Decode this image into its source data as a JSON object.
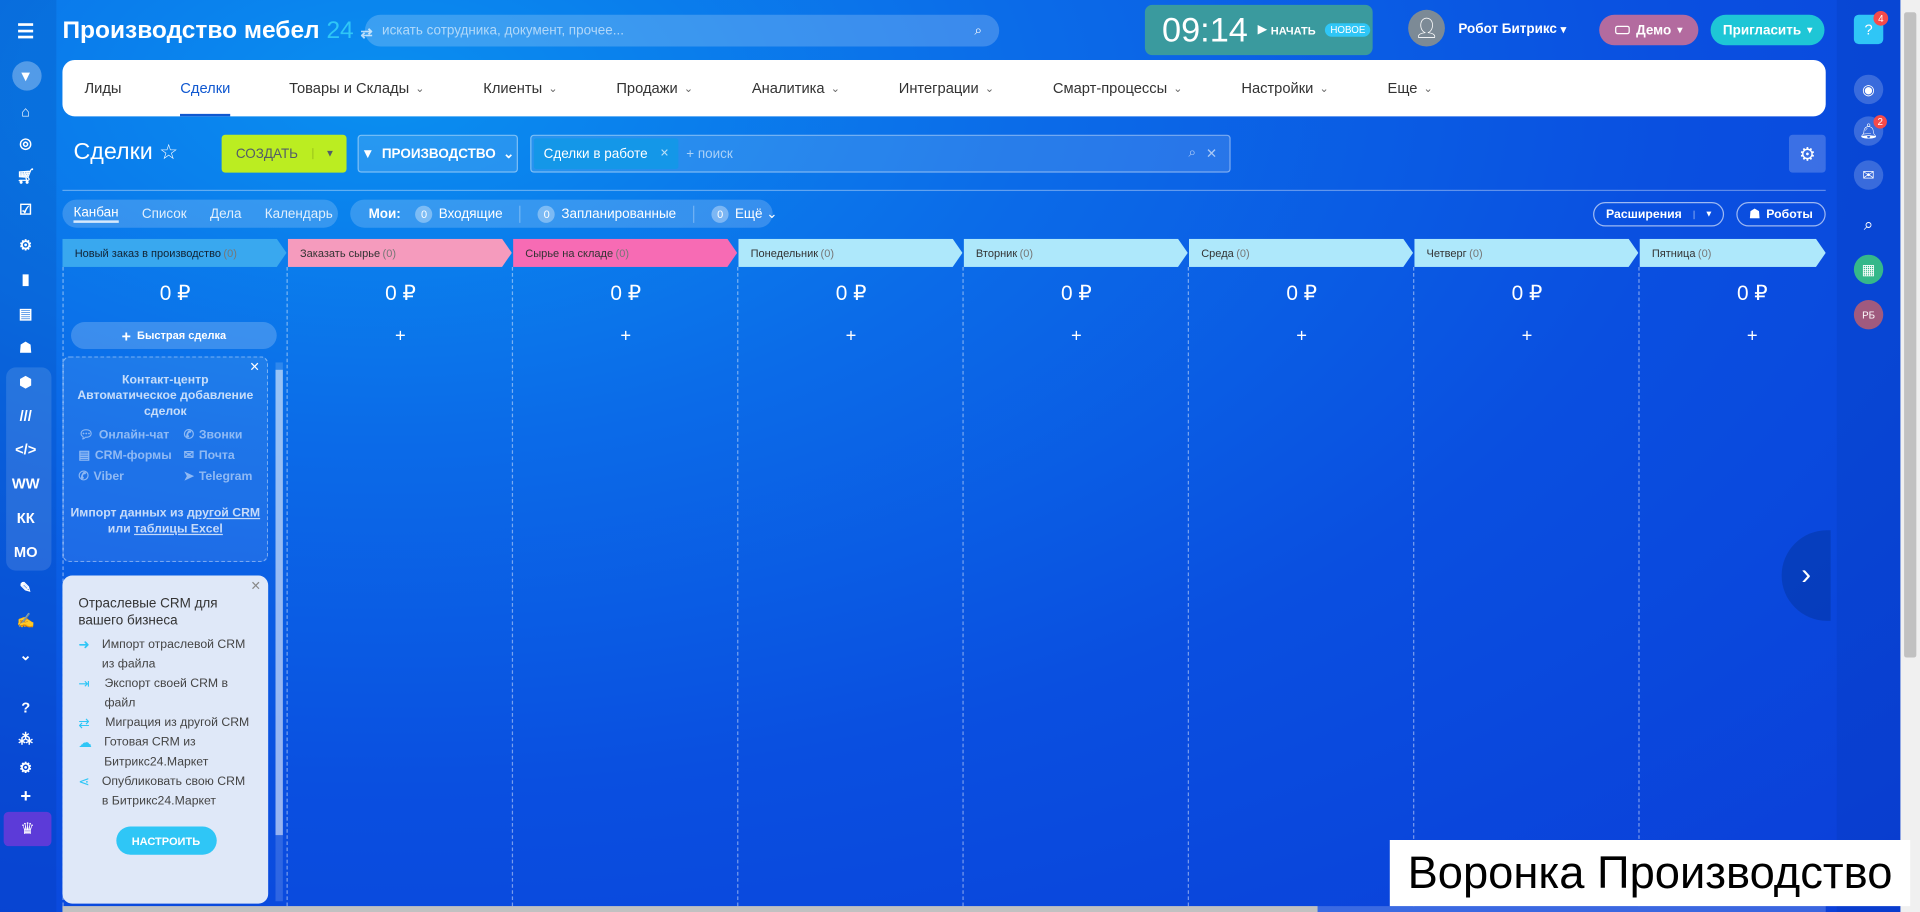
{
  "header": {
    "title": "Производство мебел",
    "title_num": "24",
    "search_placeholder": "искать сотрудника, документ, прочее...",
    "time": "09:14",
    "start_label": "НАЧАТЬ",
    "new_badge": "НОВОЕ",
    "user_name": "Робот Битрикс",
    "demo_label": "Демо",
    "invite_label": "Пригласить"
  },
  "left_sidebar": {
    "text_items": [
      "WW",
      "КК",
      "МО"
    ]
  },
  "nav": {
    "items": [
      "Лиды",
      "Сделки",
      "Товары и Склады",
      "Клиенты",
      "Продажи",
      "Аналитика",
      "Интеграции",
      "Смарт-процессы",
      "Настройки",
      "Еще"
    ]
  },
  "toolbar": {
    "title": "Сделки",
    "create_label": "СОЗДАТЬ",
    "category_label": "ПРОИЗВОДСТВО",
    "filter_tag": "Сделки в работе",
    "search_placeholder": "+ поиск"
  },
  "views": {
    "items": [
      "Канбан",
      "Список",
      "Дела",
      "Календарь"
    ]
  },
  "counters": {
    "label": "Мои:",
    "items": [
      {
        "count": "0",
        "label": "Входящие"
      },
      {
        "count": "0",
        "label": "Запланированные"
      },
      {
        "count": "0",
        "label": "Ещё"
      }
    ]
  },
  "extensions_label": "Расширения",
  "robots_label": "Роботы",
  "columns": [
    {
      "name": "Новый заказ в производство",
      "count": "(0)",
      "sum": "0 ₽",
      "color": "#39a8ef"
    },
    {
      "name": "Заказать сырье",
      "count": "(0)",
      "sum": "0 ₽",
      "color": "#f59bbd"
    },
    {
      "name": "Сырье на складе",
      "count": "(0)",
      "sum": "0 ₽",
      "color": "#f76bb4"
    },
    {
      "name": "Понедельник",
      "count": "(0)",
      "sum": "0 ₽",
      "color": "#aee8fb"
    },
    {
      "name": "Вторник",
      "count": "(0)",
      "sum": "0 ₽",
      "color": "#aee8fb"
    },
    {
      "name": "Среда",
      "count": "(0)",
      "sum": "0 ₽",
      "color": "#aee8fb"
    },
    {
      "name": "Четверг",
      "count": "(0)",
      "sum": "0 ₽",
      "color": "#aee8fb"
    },
    {
      "name": "Пятница",
      "count": "(0)",
      "sum": "0 ₽",
      "color": "#aee8fb"
    }
  ],
  "quick_deal_label": "Быстрая сделка",
  "contact_center": {
    "title": "Контакт-центр",
    "subtitle": "Автоматическое добавление сделок",
    "channels": [
      "Онлайн-чат",
      "Звонки",
      "CRM-формы",
      "Почта",
      "Viber",
      "Telegram"
    ],
    "import_text": "Импорт данных из",
    "import_link1": "другой CRM",
    "import_or": "или",
    "import_link2": "таблицы Excel"
  },
  "industry": {
    "title": "Отраслевые CRM для вашего бизнеса",
    "items": [
      "Импорт отраслевой CRM из файла",
      "Экспорт своей CRM в файл",
      "Миграция из другой CRM",
      "Готовая CRM из Битрикс24.Маркет",
      "Опубликовать свою CRM в Битрикс24.Маркет"
    ],
    "button": "НАСТРОИТЬ"
  },
  "right_bar": {
    "help_badge": "4",
    "notif_badge": "2",
    "avatar_initials": "РБ"
  },
  "caption": "Воронка Производство"
}
